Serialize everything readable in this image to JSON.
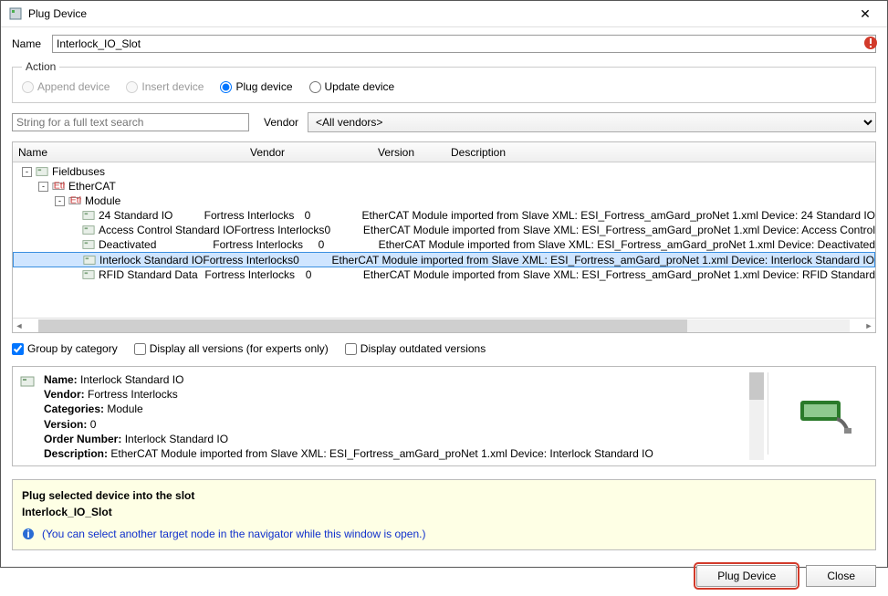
{
  "window": {
    "title": "Plug Device"
  },
  "name_row": {
    "label": "Name",
    "value": "Interlock_IO_Slot"
  },
  "action": {
    "legend": "Action",
    "options": {
      "append": "Append device",
      "insert": "Insert device",
      "plug": "Plug device",
      "update": "Update device"
    },
    "selected": "plug"
  },
  "search": {
    "placeholder": "String for a full text search",
    "vendor_label": "Vendor",
    "vendor_value": "<All vendors>"
  },
  "grid": {
    "headers": {
      "name": "Name",
      "vendor": "Vendor",
      "version": "Version",
      "description": "Description"
    },
    "tree": {
      "root": "Fieldbuses",
      "l1": "EtherCAT",
      "l2": "Module"
    },
    "rows": [
      {
        "name": "24 Standard IO",
        "vendor": "Fortress Interlocks",
        "version": "0",
        "desc": "EtherCAT Module imported from Slave XML: ESI_Fortress_amGard_proNet 1.xml Device: 24 Standard IO"
      },
      {
        "name": "Access Control Standard IO",
        "vendor": "Fortress Interlocks",
        "version": "0",
        "desc": "EtherCAT Module imported from Slave XML: ESI_Fortress_amGard_proNet 1.xml Device: Access Control"
      },
      {
        "name": "Deactivated",
        "vendor": "Fortress Interlocks",
        "version": "0",
        "desc": "EtherCAT Module imported from Slave XML: ESI_Fortress_amGard_proNet 1.xml Device: Deactivated"
      },
      {
        "name": "Interlock Standard IO",
        "vendor": "Fortress Interlocks",
        "version": "0",
        "desc": "EtherCAT Module imported from Slave XML: ESI_Fortress_amGard_proNet 1.xml Device: Interlock Standard IO"
      },
      {
        "name": "RFID Standard Data",
        "vendor": "Fortress Interlocks",
        "version": "0",
        "desc": "EtherCAT Module imported from Slave XML: ESI_Fortress_amGard_proNet 1.xml Device: RFID Standard"
      }
    ],
    "selected_index": 3
  },
  "checks": {
    "group": "Group by category",
    "allver": "Display all versions (for experts only)",
    "outdated": "Display outdated versions"
  },
  "detail": {
    "name_l": "Name:",
    "name_v": "Interlock Standard IO",
    "vendor_l": "Vendor:",
    "vendor_v": "Fortress Interlocks",
    "cat_l": "Categories:",
    "cat_v": "Module",
    "ver_l": "Version:",
    "ver_v": "0",
    "ord_l": "Order Number:",
    "ord_v": "Interlock Standard IO",
    "desc_l": "Description:",
    "desc_v": "EtherCAT Module imported from Slave XML: ESI_Fortress_amGard_proNet 1.xml Device: Interlock Standard IO"
  },
  "hint": {
    "line1": "Plug selected device into the slot",
    "line2": "Interlock_IO_Slot",
    "info": "(You can select another target node in the navigator while this window is open.)"
  },
  "buttons": {
    "plug": "Plug Device",
    "close": "Close"
  }
}
